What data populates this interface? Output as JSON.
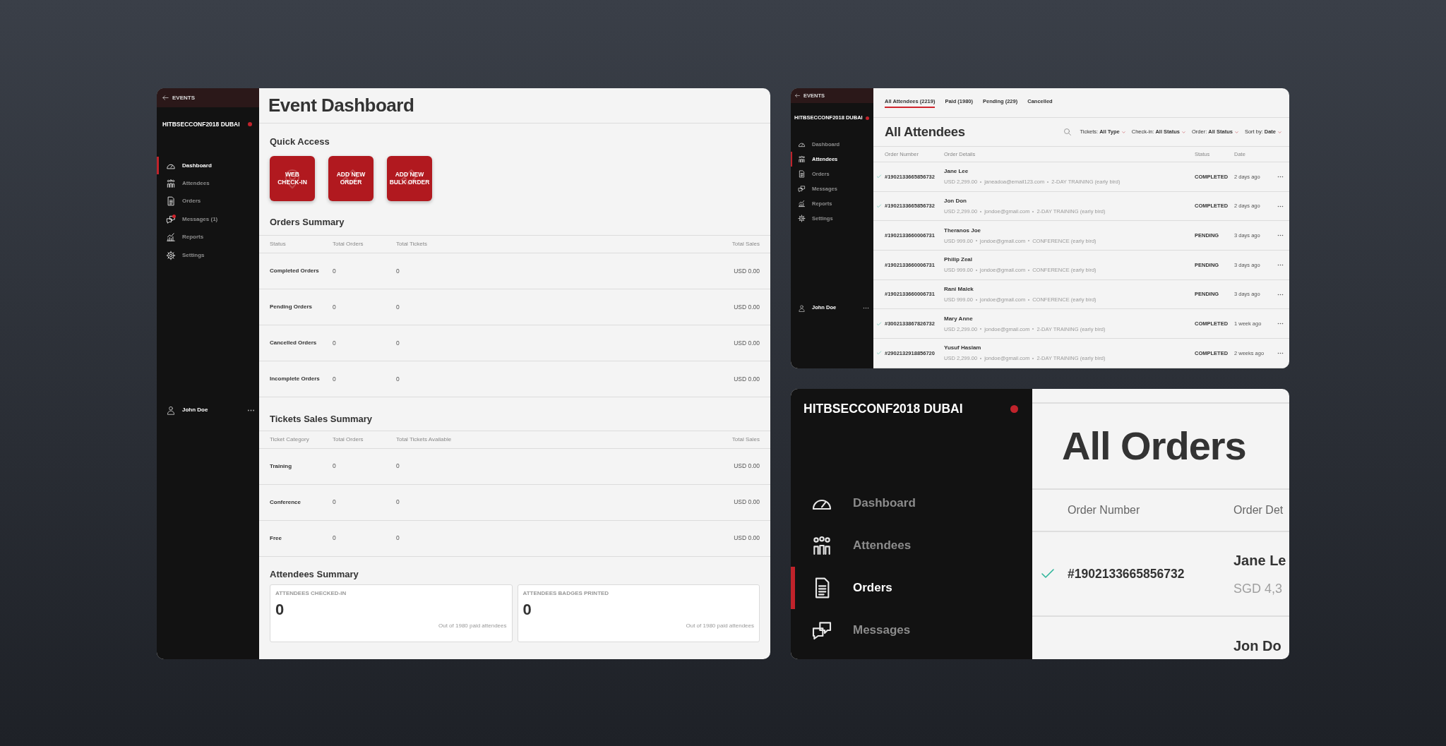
{
  "dashboard_window": {
    "sidebar": {
      "back_link": "EVENTS",
      "event_name": "HITBSECCONF2018 DUBAI",
      "nav": [
        {
          "label": "Dashboard",
          "selected": true,
          "unread": false
        },
        {
          "label": "Attendees",
          "selected": false,
          "unread": false
        },
        {
          "label": "Orders",
          "selected": false,
          "unread": false
        },
        {
          "label": "Messages (1)",
          "selected": false,
          "unread": true
        },
        {
          "label": "Reports",
          "selected": false,
          "unread": false
        },
        {
          "label": "Settings",
          "selected": false,
          "unread": false
        }
      ],
      "user": "John Doe"
    },
    "title": "Event Dashboard",
    "quick_access": {
      "title": "Quick Access",
      "buttons": [
        {
          "lines": [
            "WEB",
            "CHECK-IN"
          ]
        },
        {
          "lines": [
            "ADD NEW",
            "ORDER"
          ]
        },
        {
          "lines": [
            "ADD NEW",
            "BULK ORDER"
          ]
        }
      ]
    },
    "orders_summary": {
      "title": "Orders Summary",
      "columns": [
        "Status",
        "Total Orders",
        "Total Tickets",
        "Total Sales"
      ],
      "rows": [
        [
          "Completed Orders",
          "0",
          "0",
          "USD 0.00"
        ],
        [
          "Pending Orders",
          "0",
          "0",
          "USD 0.00"
        ],
        [
          "Cancelled Orders",
          "0",
          "0",
          "USD 0.00"
        ],
        [
          "Incomplete Orders",
          "0",
          "0",
          "USD 0.00"
        ]
      ]
    },
    "ticket_sales_summary": {
      "title": "Tickets Sales Summary",
      "columns": [
        "Ticket Category",
        "Total Orders",
        "Total Tickets Available",
        "Total Sales"
      ],
      "rows": [
        [
          "Training",
          "0",
          "0",
          "USD 0.00"
        ],
        [
          "Conference",
          "0",
          "0",
          "USD 0.00"
        ],
        [
          "Free",
          "0",
          "0",
          "USD 0.00"
        ]
      ]
    },
    "attendees_summary": {
      "title": "Attendees Summary",
      "cards": [
        {
          "label": "ATTENDEES CHECKED-IN",
          "value": "0",
          "note": "Out of 1980 paid attendees"
        },
        {
          "label": "ATTENDEES BADGES PRINTED",
          "value": "0",
          "note": "Out of 1980 paid attendees"
        }
      ]
    }
  },
  "attendees_window": {
    "sidebar": {
      "back_link": "EVENTS",
      "event_name": "HITBSECCONF2018 DUBAI",
      "nav": [
        {
          "label": "Dashboard",
          "selected": false
        },
        {
          "label": "Attendees",
          "selected": true
        },
        {
          "label": "Orders",
          "selected": false
        },
        {
          "label": "Messages",
          "selected": false
        },
        {
          "label": "Reports",
          "selected": false
        },
        {
          "label": "Settings",
          "selected": false
        }
      ],
      "user": "John Doe"
    },
    "tabs": [
      {
        "label": "All Attendees (2219)",
        "selected": true
      },
      {
        "label": "Paid (1980)",
        "selected": false
      },
      {
        "label": "Pending (229)",
        "selected": false
      },
      {
        "label": "Cancelled",
        "selected": false
      }
    ],
    "title": "All Attendees",
    "filters": [
      {
        "label": "Tickets:",
        "value": "All Type"
      },
      {
        "label": "Check-in:",
        "value": "All Status"
      },
      {
        "label": "Order:",
        "value": "All Status"
      },
      {
        "label": "Sort by:",
        "value": "Date"
      }
    ],
    "columns": [
      "Order Number",
      "Order Details",
      "Status",
      "Date"
    ],
    "rows": [
      {
        "checked": true,
        "order_number": "#1902133665856732",
        "name": "Jane Lee",
        "amount": "USD 2,299.00",
        "email": "janeadoa@email123.com",
        "ticket": "2-DAY TRAINING (early bird)",
        "status": "COMPLETED",
        "date": "2 days ago"
      },
      {
        "checked": true,
        "order_number": "#1902133665856732",
        "name": "Jon Don",
        "amount": "USD 2,299.00",
        "email": "jondoe@gmail.com",
        "ticket": "2-DAY TRAINING (early bird)",
        "status": "COMPLETED",
        "date": "2 days ago"
      },
      {
        "checked": false,
        "order_number": "#1902133660006731",
        "name": "Theranos Joe",
        "amount": "USD 999.00",
        "email": "jondoe@gmail.com",
        "ticket": "CONFERENCE (early bird)",
        "status": "PENDING",
        "date": "3 days ago"
      },
      {
        "checked": false,
        "order_number": "#1902133660006731",
        "name": "Philip Zeal",
        "amount": "USD 999.00",
        "email": "jondoe@gmail.com",
        "ticket": "CONFERENCE (early bird)",
        "status": "PENDING",
        "date": "3 days ago"
      },
      {
        "checked": false,
        "order_number": "#1902133660006731",
        "name": "Rani Malek",
        "amount": "USD 999.00",
        "email": "jondoe@gmail.com",
        "ticket": "CONFERENCE (early bird)",
        "status": "PENDING",
        "date": "3 days ago"
      },
      {
        "checked": true,
        "order_number": "#3002133867826732",
        "name": "Mary Anne",
        "amount": "USD 2,299.00",
        "email": "jondoe@gmail.com",
        "ticket": "2-DAY TRAINING (early bird)",
        "status": "COMPLETED",
        "date": "1 week ago"
      },
      {
        "checked": true,
        "order_number": "#2902132918856720",
        "name": "Yusuf Haslam",
        "amount": "USD 2,299.00",
        "email": "jondoe@gmail.com",
        "ticket": "2-DAY TRAINING (early bird)",
        "status": "COMPLETED",
        "date": "2 weeks ago"
      }
    ]
  },
  "orders_window": {
    "sidebar": {
      "event_name": "HITBSECCONF2018 DUBAI",
      "nav": [
        {
          "label": "Dashboard",
          "selected": false
        },
        {
          "label": "Attendees",
          "selected": false
        },
        {
          "label": "Orders",
          "selected": true
        },
        {
          "label": "Messages",
          "selected": false
        }
      ]
    },
    "title": "All Orders",
    "columns": [
      "Order Number",
      "Order Det"
    ],
    "rows": [
      {
        "checked": true,
        "order_number": "#1902133665856732",
        "name": "Jane Le",
        "detail": "SGD 4,3"
      },
      {
        "name": "Jon Do"
      }
    ]
  }
}
